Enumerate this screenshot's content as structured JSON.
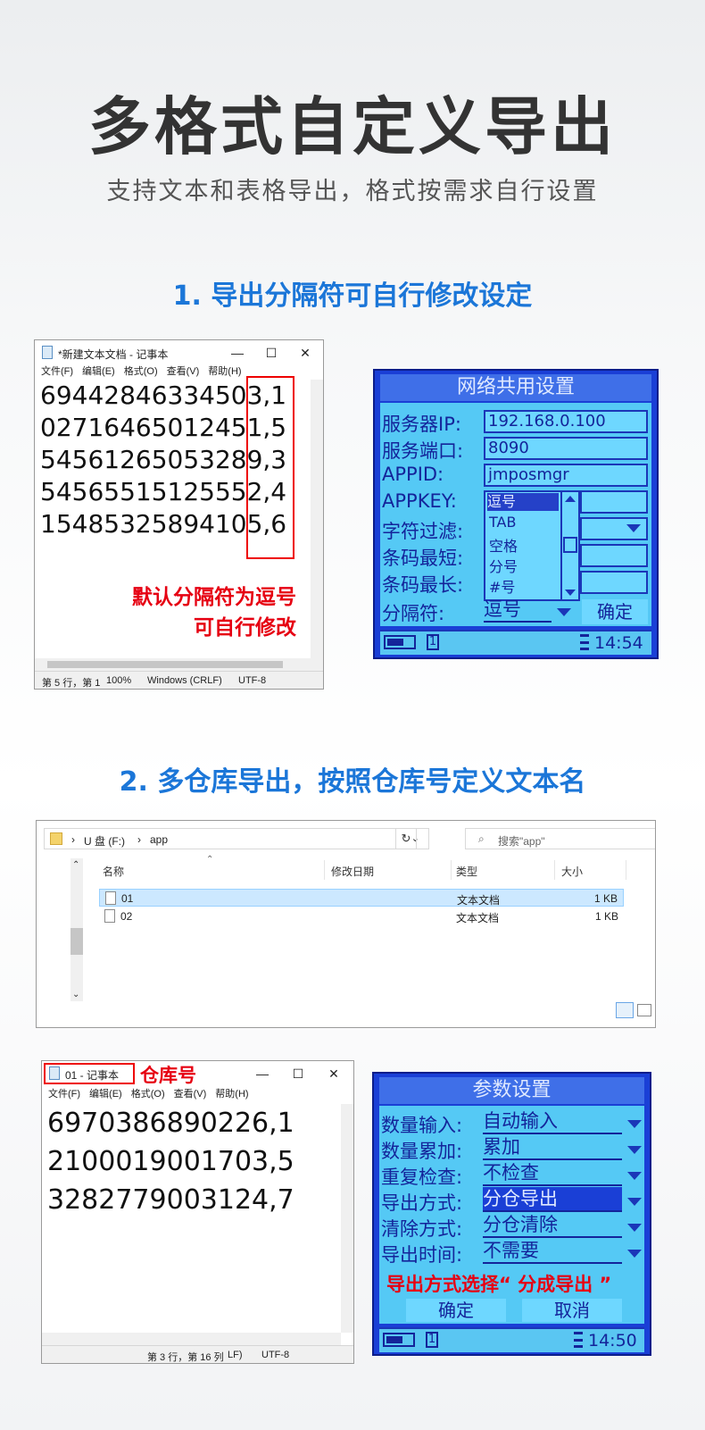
{
  "header": {
    "title": "多格式自定义导出",
    "subtitle": "支持文本和表格导出，格式按需求自行设置"
  },
  "section1": {
    "title": "1. 导出分隔符可自行修改设定"
  },
  "section2": {
    "title": "2. 多仓库导出，按照仓库号定义文本名"
  },
  "notepad1": {
    "title": "*新建文本文档 - 记事本",
    "menu": [
      "文件(F)",
      "编辑(E)",
      "格式(O)",
      "查看(V)",
      "帮助(H)"
    ],
    "lines": [
      "69442846334503,1",
      "02716465012451,5",
      "54561265053289,3",
      "54565515125552,4",
      "15485325894105,6"
    ],
    "annotation_line1": "默认分隔符为逗号",
    "annotation_line2": "可自行修改",
    "status": {
      "pos": "第 5 行，第 1",
      "zoom": "100%",
      "eol": "Windows (CRLF)",
      "enc": "UTF-8"
    }
  },
  "lcd1": {
    "header": "网络共用设置",
    "rows": [
      {
        "label": "服务器IP:",
        "value": "192.168.0.100"
      },
      {
        "label": "服务端口:",
        "value": "8090"
      },
      {
        "label": "APPID:",
        "value": "jmposmgr"
      },
      {
        "label": "APPKEY:",
        "value": ""
      },
      {
        "label": "字符过滤:",
        "value": ""
      },
      {
        "label": "条码最短:",
        "value": ""
      },
      {
        "label": "条码最长:",
        "value": ""
      }
    ],
    "dropdown_options": [
      "逗号",
      "TAB",
      "空格",
      "分号",
      "#号"
    ],
    "separator_label": "分隔符:",
    "separator_value": "逗号",
    "confirm": "确定",
    "tab_number": "1",
    "time": "14:54"
  },
  "explorer": {
    "breadcrumb": [
      "U 盘 (F:)",
      "app"
    ],
    "search_placeholder": "搜索\"app\"",
    "columns": [
      "名称",
      "修改日期",
      "类型",
      "大小"
    ],
    "files": [
      {
        "name": "01",
        "type": "文本文档",
        "size": "1 KB"
      },
      {
        "name": "02",
        "type": "文本文档",
        "size": "1 KB"
      }
    ]
  },
  "notepad2": {
    "title": "01 - 记事本",
    "annotation": "仓库号",
    "menu": [
      "文件(F)",
      "编辑(E)",
      "格式(O)",
      "查看(V)",
      "帮助(H)"
    ],
    "lines": [
      "6970386890226,1",
      "2100019001703,5",
      "3282779003124,7"
    ],
    "status": {
      "pos": "第 3 行，第 16 列",
      "eol": "LF)",
      "enc": "UTF-8"
    }
  },
  "lcd2": {
    "header": "参数设置",
    "rows": [
      {
        "label": "数量输入:",
        "value": "自动输入"
      },
      {
        "label": "数量累加:",
        "value": "累加"
      },
      {
        "label": "重复检查:",
        "value": "不检查"
      },
      {
        "label": "导出方式:",
        "value": "分仓导出"
      },
      {
        "label": "清除方式:",
        "value": "分仓清除"
      },
      {
        "label": "导出时间:",
        "value": "不需要"
      }
    ],
    "annotation": "导出方式选择“ 分成导出 ”",
    "confirm": "确定",
    "cancel": "取消",
    "tab_number": "1",
    "time": "14:50"
  }
}
